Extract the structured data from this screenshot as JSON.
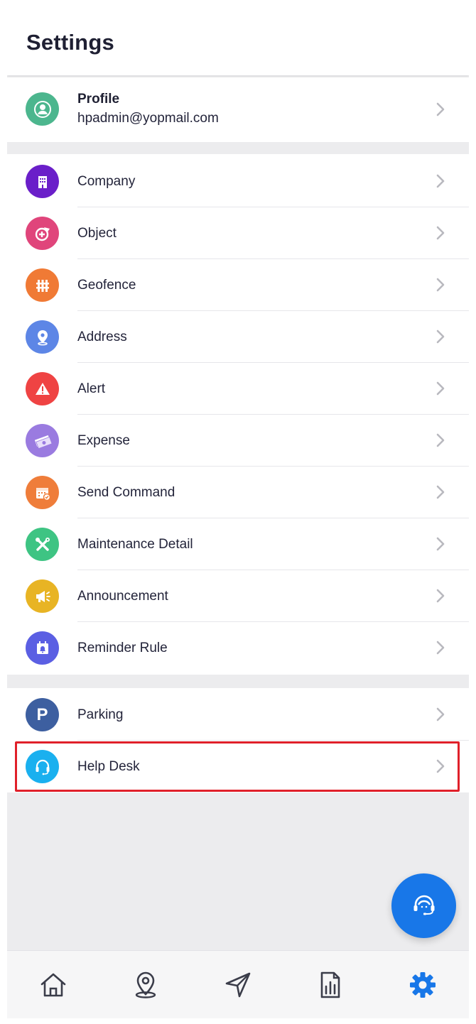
{
  "header": {
    "title": "Settings"
  },
  "profile": {
    "title": "Profile",
    "email": "hpadmin@yopmail.com",
    "icon": "profile-icon",
    "color": "#4cb68e"
  },
  "main_items": [
    {
      "label": "Company",
      "icon": "building-icon",
      "color": "#6a1fc9"
    },
    {
      "label": "Object",
      "icon": "object-icon",
      "color": "#e0457b"
    },
    {
      "label": "Geofence",
      "icon": "geofence-icon",
      "color": "#f07a35"
    },
    {
      "label": "Address",
      "icon": "location-pin-icon",
      "color": "#5d86e6"
    },
    {
      "label": "Alert",
      "icon": "warning-icon",
      "color": "#ef4343"
    },
    {
      "label": "Expense",
      "icon": "money-icon",
      "color": "#9a7be0"
    },
    {
      "label": "Send Command",
      "icon": "calendar-command-icon",
      "color": "#ef7d3a"
    },
    {
      "label": "Maintenance Detail",
      "icon": "tools-icon",
      "color": "#3ec483"
    },
    {
      "label": "Announcement",
      "icon": "megaphone-icon",
      "color": "#e8b424"
    },
    {
      "label": "Reminder Rule",
      "icon": "calendar-reminder-icon",
      "color": "#5b5fe3"
    }
  ],
  "extra_items": [
    {
      "label": "Parking",
      "icon": "parking-icon",
      "color": "#3d5fa0"
    },
    {
      "label": "Help Desk",
      "icon": "headset-icon",
      "color": "#1ab0ef"
    }
  ],
  "fab": {
    "icon": "support-agent-icon",
    "color": "#1877e8"
  },
  "tabbar": [
    {
      "name": "home",
      "icon": "home-icon"
    },
    {
      "name": "map",
      "icon": "map-pin-icon"
    },
    {
      "name": "navigate",
      "icon": "navigation-icon"
    },
    {
      "name": "reports",
      "icon": "report-icon"
    },
    {
      "name": "settings",
      "icon": "gear-icon",
      "active": true,
      "color": "#1877e8"
    }
  ]
}
